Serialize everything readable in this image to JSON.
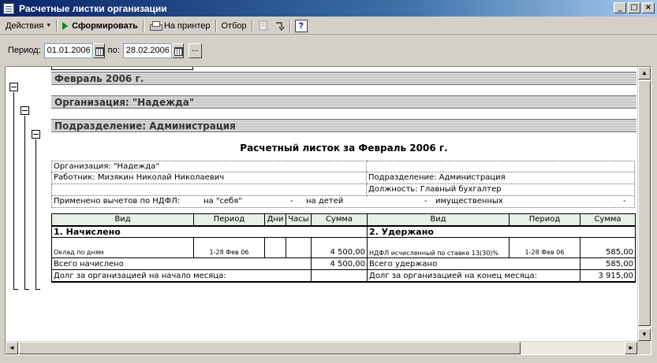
{
  "window": {
    "title": "Расчетные листки организации",
    "minimize_glyph": "_",
    "maximize_glyph": "□",
    "close_glyph": "×"
  },
  "toolbar": {
    "actions_label": "Действия",
    "actions_arrow": "▼",
    "form_label": "Сформировать",
    "print_label": "На принтер",
    "select_label": "Отбор",
    "help_glyph": "?"
  },
  "period": {
    "label": "Период:",
    "from": "01.01.2006",
    "to_label": "по:",
    "to": "28.02.2006",
    "dots": "..."
  },
  "report": {
    "group_month": "Февраль 2006 г.",
    "group_org": "Организация: \"Надежда\"",
    "group_dept": "Подразделение: Администрация",
    "title": "Расчетный листок за Февраль 2006 г.",
    "info": {
      "org": "Организация: \"Надежда\"",
      "employee": "Работник: Мизякин Николай Николаевич",
      "dept": "Подразделение: Администрация",
      "position": "Должность: Главный бухгалтер",
      "ndfl_label": "Применено вычетов по НДФЛ:",
      "self_label": "на \"себя\"",
      "self_value": "-",
      "children_label": "на детей",
      "children_value": "-",
      "property_label": "имущественных",
      "property_value": "-"
    },
    "columns": {
      "left": [
        "Вид",
        "Период",
        "Дни",
        "Часы",
        "Сумма"
      ],
      "right": [
        "Вид",
        "Период",
        "Сумма"
      ]
    },
    "accrued_title": "1. Начислено",
    "withheld_title": "2. Удержано",
    "accrued_rows": [
      {
        "kind": "Оклад по дням",
        "period": "1-28 Фев 06",
        "days": "",
        "hours": "",
        "sum": "4 500,00"
      }
    ],
    "withheld_rows": [
      {
        "kind": "НДФЛ исчисленный по ставке 13(30)%",
        "period": "1-28 Фев 06",
        "sum": "585,00"
      }
    ],
    "total_accrued_label": "Всего начислено",
    "total_accrued": "4 500,00",
    "total_withheld_label": "Всего удержано",
    "total_withheld": "585,00",
    "debt_start_label": "Долг за организацией на начало месяца:",
    "debt_start": "",
    "debt_end_label": "Долг за организацией на конец месяца:",
    "debt_end": "3 915,00"
  },
  "scrollbars": {
    "up": "▲",
    "down": "▼",
    "left": "◄",
    "right": "►"
  }
}
